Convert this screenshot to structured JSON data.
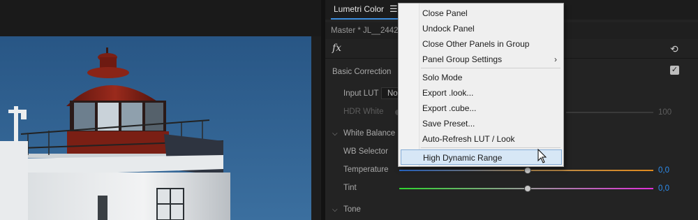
{
  "panel": {
    "tab_title": "Lumetri Color",
    "menu_icon": "hamburger-menu-icon",
    "master_label": "Master * JL__2442(",
    "fx_icon": "fx-icon",
    "reset_icon": "reset-icon"
  },
  "basic": {
    "section_label": "Basic Correction",
    "enabled": true,
    "input_lut_label": "Input LUT",
    "input_lut_value": "No",
    "hdr_white_label": "HDR White",
    "hdr_white_value": "100",
    "white_balance_label": "White Balance",
    "wb_selector_label": "WB Selector",
    "temperature_label": "Temperature",
    "temperature_value": "0,0",
    "tint_label": "Tint",
    "tint_value": "0,0",
    "tone_label": "Tone"
  },
  "menu": {
    "items": [
      {
        "label": "Close Panel"
      },
      {
        "label": "Undock Panel"
      },
      {
        "label": "Close Other Panels in Group"
      },
      {
        "label": "Panel Group Settings",
        "submenu": true
      },
      {
        "label": "Solo Mode"
      },
      {
        "label": "Export .look..."
      },
      {
        "label": "Export .cube..."
      },
      {
        "label": "Save Preset..."
      },
      {
        "label": "Auto-Refresh LUT / Look"
      },
      {
        "label": "High Dynamic Range",
        "highlighted": true
      }
    ],
    "submenu_arrow": "›"
  },
  "colors": {
    "accent": "#2d8ceb",
    "highlight_bg": "#d7e7f6",
    "sky": "#2f5f8e",
    "lighthouse_red": "#7a1f14"
  }
}
